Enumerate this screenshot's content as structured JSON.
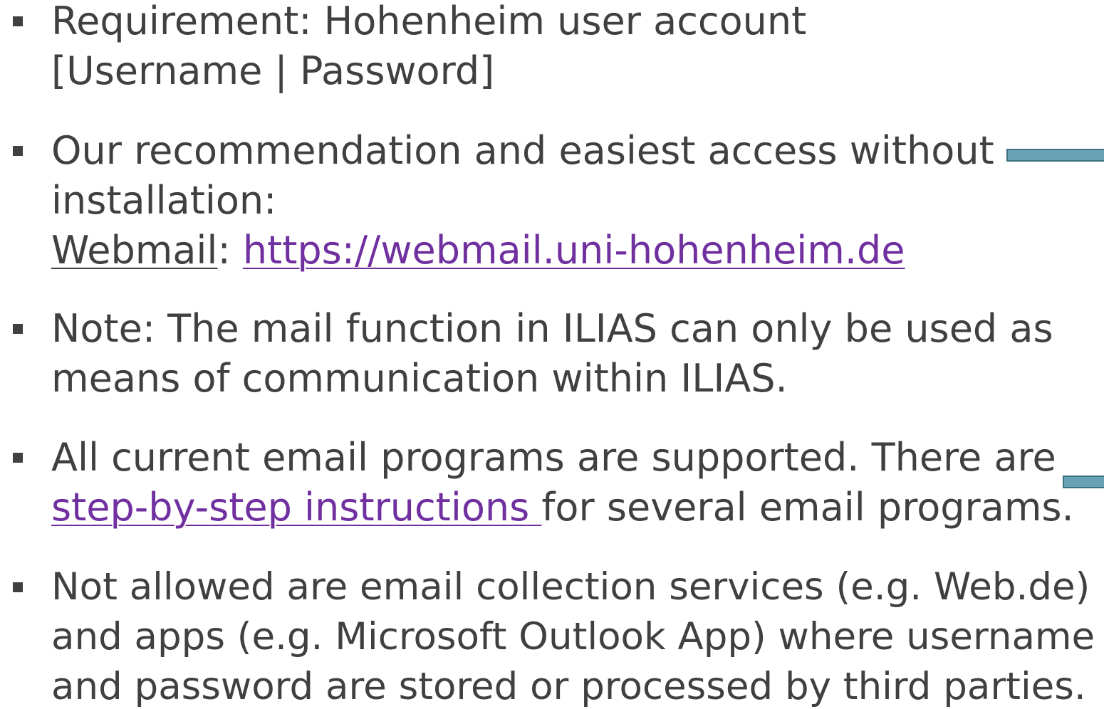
{
  "bullets": [
    {
      "line1": "Requirement: Hohenheim user account",
      "line2": "[Username | Password]"
    },
    {
      "line1": "Our recommendation and easiest access without",
      "line2": "installation:",
      "webmail_label": "Webmail",
      "separator": ":",
      "webmail_url": "https://webmail.uni-hohenheim.de"
    },
    {
      "line1": "Note: The mail function in ILIAS can only be used as",
      "line2": "means of communication within ILIAS."
    },
    {
      "line1": "All current email programs are supported. There are",
      "link_text": "step-by-step instructions ",
      "line2_rest": "for several email programs."
    },
    {
      "line1": "Not allowed are email collection services (e.g. Web.de)",
      "line2": "and apps (e.g. Microsoft Outlook App) where username",
      "line3": "and password are stored or processed by third parties."
    }
  ],
  "colors": {
    "text": "#404040",
    "link": "#7030A0",
    "accent_bar": "#6aa2b5"
  }
}
